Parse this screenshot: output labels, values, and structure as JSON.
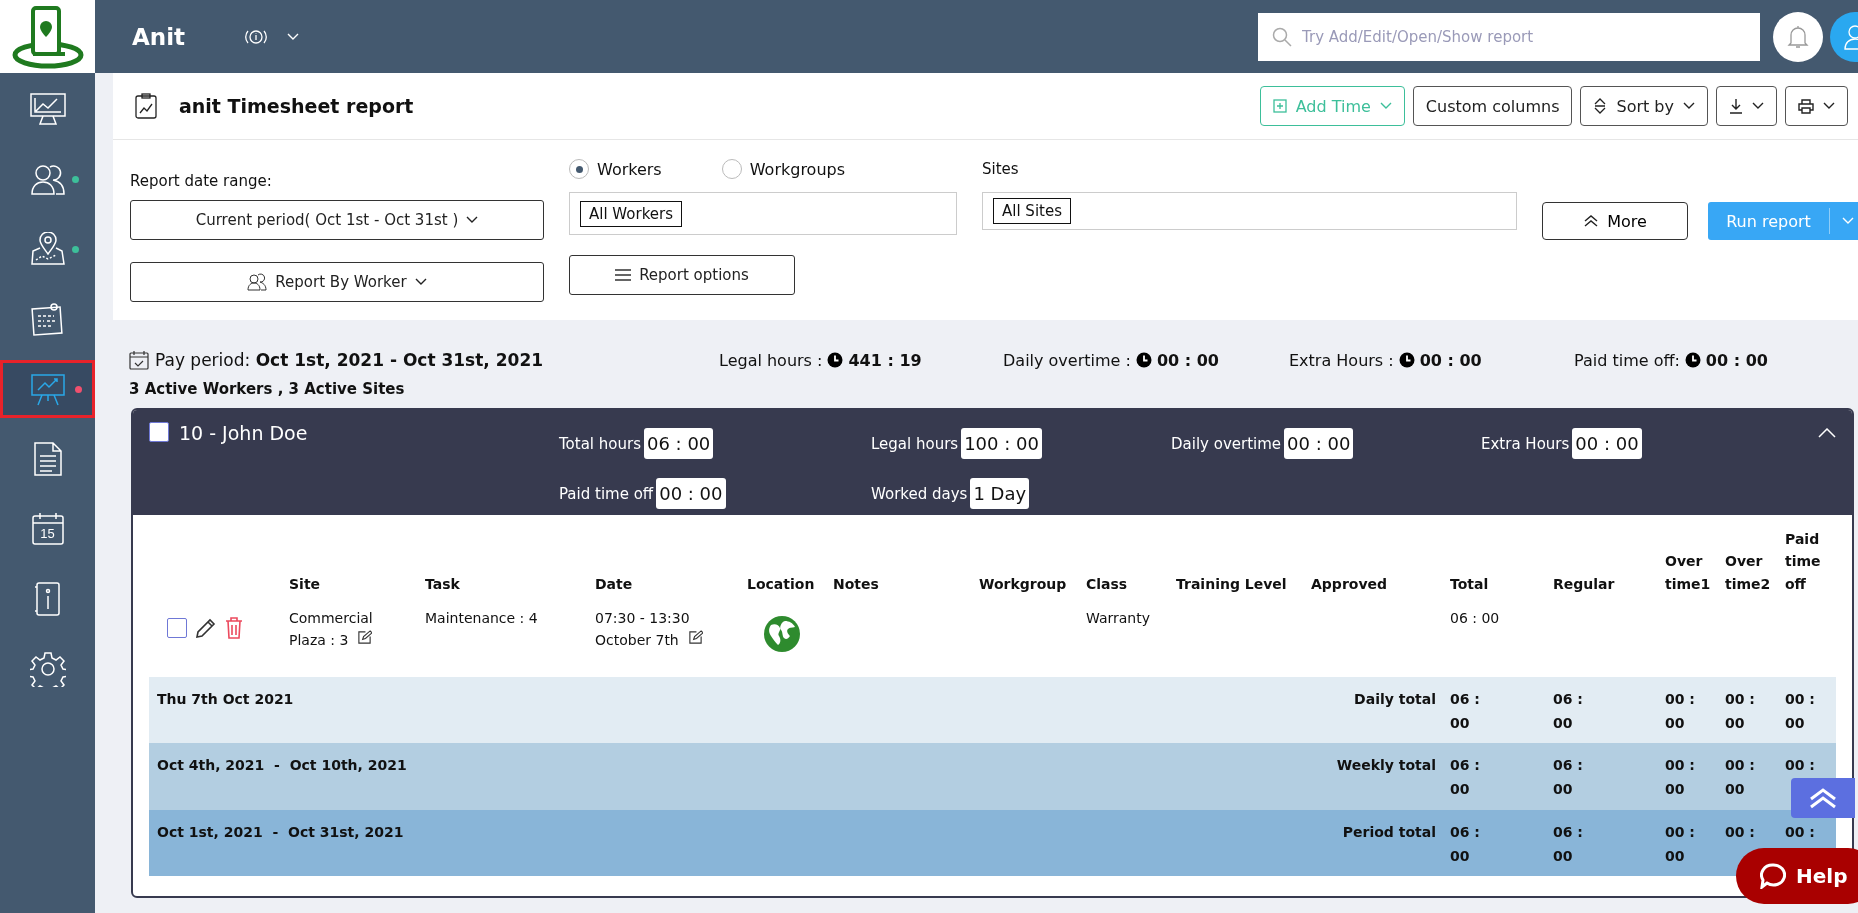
{
  "app": {
    "name": "Anit"
  },
  "search": {
    "placeholder": "Try Add/Edit/Open/Show report"
  },
  "sidebar": {
    "items": [
      {
        "kind": "dashboard",
        "selected": false
      },
      {
        "kind": "workers",
        "selected": false,
        "color": "#3dbf9a"
      },
      {
        "kind": "map",
        "selected": false,
        "color": "#3dbf9a"
      },
      {
        "kind": "board",
        "selected": false
      },
      {
        "kind": "reports",
        "selected": true,
        "color": "#f0506e"
      },
      {
        "kind": "document",
        "selected": false
      },
      {
        "kind": "calendar",
        "selected": false,
        "label": "15"
      },
      {
        "kind": "book",
        "selected": false
      },
      {
        "kind": "settings",
        "selected": false
      }
    ]
  },
  "report": {
    "title": "anit Timesheet report",
    "toolbar": [
      {
        "kind": "add",
        "label": "Add Time"
      },
      {
        "kind": "plain",
        "label": "Custom columns"
      },
      {
        "kind": "sort",
        "label": "Sort by"
      },
      {
        "kind": "download"
      },
      {
        "kind": "print"
      }
    ]
  },
  "filters": {
    "date_range_label": "Report date range:",
    "date_range": "Current period( Oct 1st - Oct 31st )",
    "group_by": "Report By Worker",
    "radios": [
      {
        "label": "Workers",
        "selected": true
      },
      {
        "label": "Workgroups",
        "selected": false
      }
    ],
    "workers_tag": "All Workers",
    "report_options": "Report options",
    "sites_label": "Sites",
    "sites_tag": "All Sites",
    "more": "More",
    "run": "Run report"
  },
  "summary": {
    "pay_period": "Pay period: **Oct 1st, 2021 - Oct 31st, 2021**",
    "active": "3 Active Workers , 3 Active Sites",
    "stats": [
      {
        "label": "Legal hours :",
        "value": "441 : 19"
      },
      {
        "label": "Daily overtime :",
        "value": "00 : 00"
      },
      {
        "label": "Extra Hours :",
        "value": "00 : 00"
      },
      {
        "label": "Paid time off:",
        "value": "00 : 00"
      }
    ]
  },
  "worker": {
    "checked": false,
    "name": "10 - John Doe",
    "expanded": true,
    "stats": [
      {
        "label": "Total hours",
        "value": "06 : 00"
      },
      {
        "label": "Legal hours",
        "value": "100 : 00"
      },
      {
        "label": "Daily overtime",
        "value": "00 : 00"
      },
      {
        "label": "Extra Hours",
        "value": "00 : 00"
      },
      {
        "label": "Paid time off",
        "value": "00 : 00"
      },
      {
        "label": "Worked days",
        "value": "1 Day"
      }
    ]
  },
  "table": {
    "columns": [
      "Site",
      "Task",
      "Date",
      "Location",
      "Notes",
      "Workgroup",
      "Class",
      "Training Level",
      "Approved",
      "Total",
      "Regular",
      "Over time1",
      "Over time2",
      "Paid time off"
    ],
    "rows": [
      {
        "checked": false,
        "site": "Commercial Plaza : 3",
        "task": "Maintenance : 4",
        "time": "07:30 - 13:30",
        "date": "October 7th",
        "class": "Warranty",
        "total": "06 : 00"
      }
    ],
    "totals": [
      {
        "kind": "daily",
        "period": "Thu 7th Oct 2021",
        "label": "Daily total",
        "values": [
          "06 : 00",
          "06 : 00",
          "00 : 00",
          "00 : 00",
          "00 : 00"
        ]
      },
      {
        "kind": "weekly",
        "period": "Oct 4th, 2021  -  Oct 10th, 2021",
        "label": "Weekly total",
        "values": [
          "06 : 00",
          "06 : 00",
          "00 : 00",
          "00 : 00",
          "00 :"
        ]
      },
      {
        "kind": "period",
        "period": "Oct 1st, 2021  -  Oct 31st, 2021",
        "label": "Period total",
        "values": [
          "06 : 00",
          "06 : 00",
          "00 : 00",
          "00 :",
          "00 :"
        ]
      }
    ]
  },
  "help": {
    "label": "Help"
  }
}
